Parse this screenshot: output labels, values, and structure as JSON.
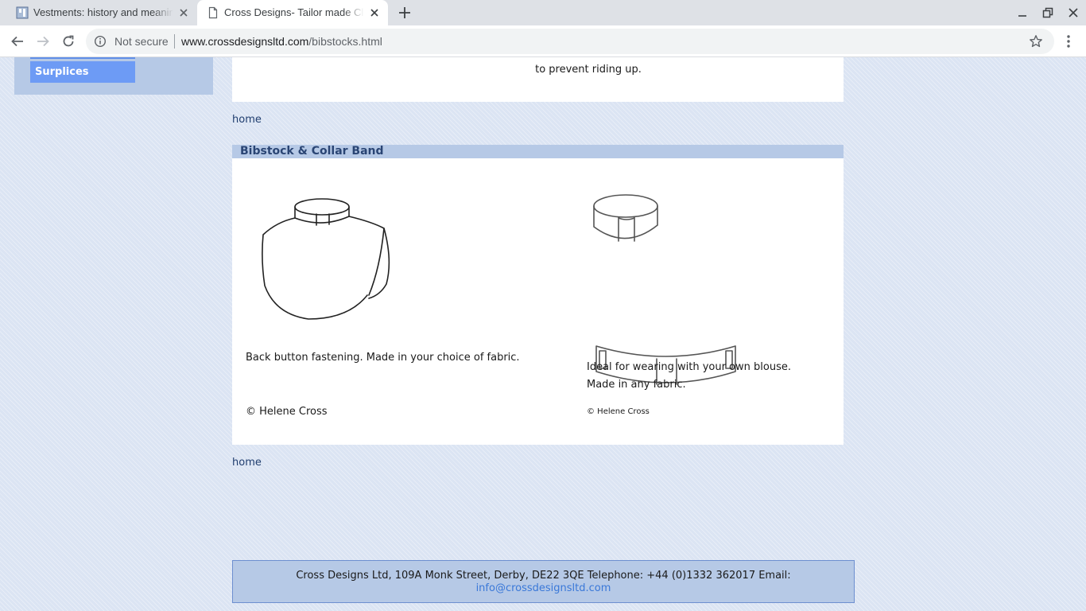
{
  "browser": {
    "tabs": [
      {
        "title": "Vestments: history and meaning",
        "active": false,
        "favicon": "vestments-favicon"
      },
      {
        "title": "Cross Designs- Tailor made Clergy",
        "active": true,
        "favicon": "page-icon"
      }
    ],
    "address": {
      "security_label": "Not secure",
      "url_host": "www.crossdesignsltd.com",
      "url_path": "/bibstocks.html"
    }
  },
  "sidebar": {
    "items": [
      {
        "label": "Surplices"
      }
    ]
  },
  "content": {
    "top_text": "to prevent riding up.",
    "home_label": "home",
    "section": {
      "title": "Bibstock & Collar Band",
      "left": {
        "image": "bibstock-drawing",
        "caption": "Back button fastening. Made in your choice of fabric.",
        "copyright": "© Helene Cross"
      },
      "right": {
        "image": "collar-band-drawing",
        "caption_line1": "Ideal for wearing with your own blouse.",
        "caption_line2": "Made in any fabric.",
        "copyright": "© Helene Cross"
      }
    }
  },
  "footer": {
    "text": "Cross Designs Ltd, 109A Monk Street, Derby, DE22 3QE Telephone: +44 (0)1332 362017 Email:",
    "email": "info@crossdesignsltd.com"
  },
  "colors": {
    "page_bg": "#dbe4f3",
    "sidebar_bg": "#b6c9e6",
    "sidebar_link_bg": "#6d9bf5",
    "section_head": "#2a4574",
    "link": "#3a78d8"
  }
}
